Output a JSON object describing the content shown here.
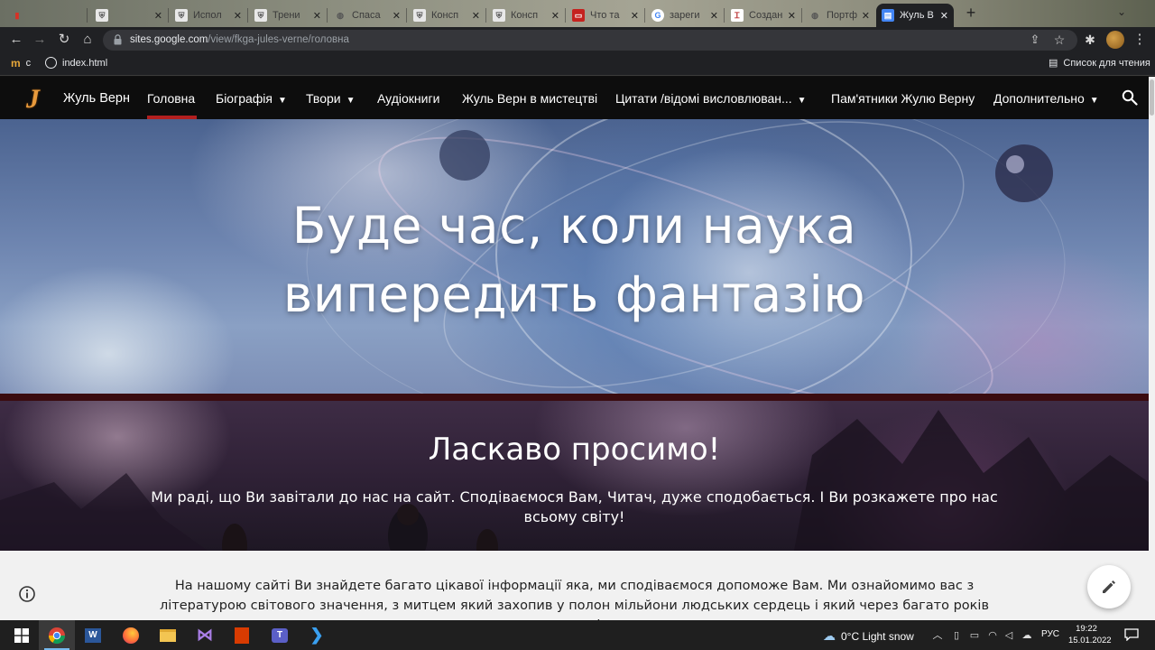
{
  "browser": {
    "tabs": [
      {
        "title": "",
        "favicon": "colorful-icon",
        "color": "#d93025"
      },
      {
        "title": "",
        "favicon": "shield-icon",
        "color": "#555"
      },
      {
        "title": "Испол",
        "favicon": "shield-icon",
        "color": "#555"
      },
      {
        "title": "Трени",
        "favicon": "shield-icon",
        "color": "#555"
      },
      {
        "title": "Спаса",
        "favicon": "globe-icon",
        "color": "#555"
      },
      {
        "title": "Консп",
        "favicon": "shield-icon",
        "color": "#555"
      },
      {
        "title": "Консп",
        "favicon": "shield-icon",
        "color": "#555"
      },
      {
        "title": "Что та",
        "favicon": "red-book-icon",
        "color": "#c5221f"
      },
      {
        "title": "зареги",
        "favicon": "google-icon",
        "color": "#4285f4"
      },
      {
        "title": "Создан",
        "favicon": "text-icon",
        "color": "#b33"
      },
      {
        "title": "Портф",
        "favicon": "globe-icon",
        "color": "#555"
      },
      {
        "title": "Жуль В",
        "favicon": "sites-icon",
        "color": "#4285f4"
      }
    ],
    "url_host": "sites.google.com",
    "url_path": "/view/fkga-jules-verne/головна",
    "bookmarks": [
      {
        "label": "c",
        "icon": "m-icon"
      },
      {
        "label": "index.html",
        "icon": "globe-icon"
      }
    ],
    "reading_list": "Список для чтения"
  },
  "site": {
    "logo": "J",
    "name": "Жуль Верн",
    "nav": [
      {
        "label": "Головна",
        "dropdown": false,
        "active": true
      },
      {
        "label": "Біографія",
        "dropdown": true
      },
      {
        "label": "Твори",
        "dropdown": true
      },
      {
        "label": "Аудіокниги",
        "dropdown": false
      },
      {
        "label": "Жуль Верн в мистецтві",
        "dropdown": false
      },
      {
        "label": "Цитати /відомі висловлюван...",
        "dropdown": true
      },
      {
        "label": "Пам'ятники Жулю Верну",
        "dropdown": false
      },
      {
        "label": "Дополнительно",
        "dropdown": true
      }
    ],
    "accent": "#b21f1f"
  },
  "hero": {
    "line1": "Буде час, коли наука",
    "line2": "випередить фантазію"
  },
  "welcome": {
    "title": "Ласкаво просимо!",
    "text": "Ми раді, що Ви завітали до нас на сайт. Сподіваємося Вам, Читач, дуже сподобається. І Ви розкажете про нас всьому світу!"
  },
  "content": {
    "text": "На нашому сайті Ви знайдете багато цікавої інформації яка, ми сподіваємося допоможе Вам. Ми ознайомимо вас з літературою світового значення, з митцем який захопив у  полон мільйони людських сердець і який через багато років не перестає цікавити"
  },
  "taskbar": {
    "apps": [
      "windows-icon",
      "chrome-icon",
      "word-icon",
      "firefox-icon",
      "explorer-icon",
      "visual-studio-icon",
      "office-icon",
      "teams-icon",
      "vscode-icon"
    ],
    "weather": "0°C  Light snow",
    "lang": "РУС",
    "time": "19:22",
    "date": "15.01.2022"
  }
}
